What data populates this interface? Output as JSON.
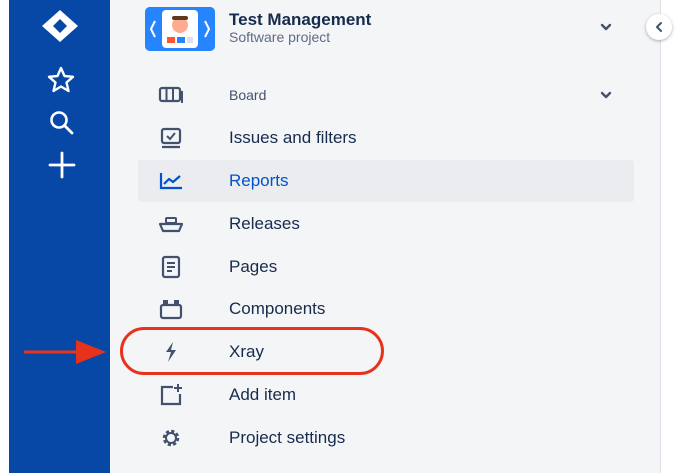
{
  "project": {
    "name": "Test Management",
    "type": "Software project"
  },
  "nav": {
    "items": [
      {
        "label": "Board",
        "icon": "board-icon"
      },
      {
        "label": "Issues and filters",
        "icon": "issues-icon"
      },
      {
        "label": "Reports",
        "icon": "reports-icon",
        "selected": true
      },
      {
        "label": "Releases",
        "icon": "releases-icon"
      },
      {
        "label": "Pages",
        "icon": "pages-icon"
      },
      {
        "label": "Components",
        "icon": "components-icon"
      },
      {
        "label": "Xray",
        "icon": "xray-icon"
      },
      {
        "label": "Add item",
        "icon": "add-item-icon"
      },
      {
        "label": "Project settings",
        "icon": "settings-icon"
      }
    ]
  },
  "global_nav_icons": [
    "jira-logo-icon",
    "star-icon",
    "search-icon",
    "plus-icon"
  ],
  "colors": {
    "global_nav": "#0747a6",
    "sidebar": "#f4f5f7",
    "selected_text": "#0052cc",
    "highlight": "#e8331c"
  }
}
